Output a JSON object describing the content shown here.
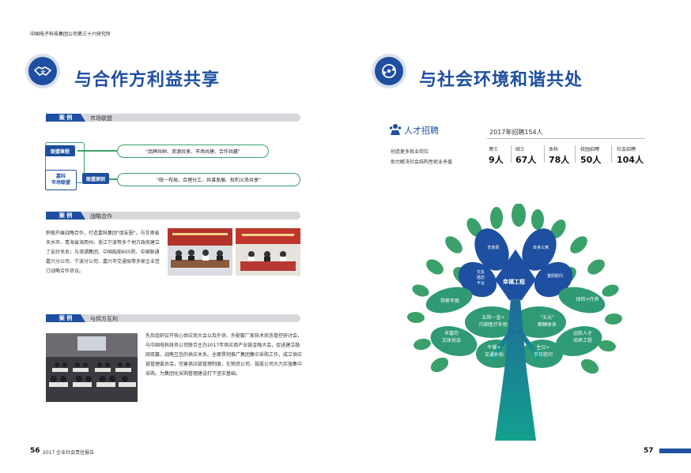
{
  "header": {
    "title": "中国电子科技集团公司第三十六研究所"
  },
  "left_section": {
    "title": "与合作方利益共享",
    "case_tag": "案 例",
    "cases": [
      {
        "name": "市场联盟"
      },
      {
        "name": "战略合作"
      },
      {
        "name": "与供方互利"
      }
    ],
    "alliance": {
      "box1": "联盟章程",
      "box2": "嘉科\n市场联盟",
      "box3": "联盟原则",
      "pill1": "\"品牌共树、资源共享、市场共建、合作共赢\"",
      "pill2": "\"统一布局、合理分工、共谋发展、权利义务共享\""
    },
    "strategic_text": "积极开展战略合作，打造嘉科集团\"朋友圈\"。与甘肃省天水市、青海省海西州、浙江宁波等多个地方政府建立了友好关系；与浪潮集团、中国船舶605院、中国联通嘉兴分公司、宁波分公司、嘉兴市交通局等多家企业签订战略合作协议。",
    "supplier_text": "先后组织召开核心供应商大会以及外协、外配套厂家技术状态管控研讨会，与中国电科财务公司联合主办2017年供应商产业链金融大会，促进建立稳固双赢、战略互信的供应关系。全面贯彻推广集团集中采购工作，成立供应链管理委员会，完善供应链管理制度，在物资公司、投股公司大力实施集中采购，为集团化采购管理建设打下坚实基础。"
  },
  "right_section": {
    "title": "与社会环境和谐共处",
    "talent": {
      "label": "人才招聘",
      "year_total": "2017年招聘154人",
      "desc1": "创造更多就业岗位",
      "desc2": "助力解决社会结构性就业矛盾",
      "stats": [
        {
          "head": "博士",
          "val": "9人"
        },
        {
          "head": "硕士",
          "val": "67人"
        },
        {
          "head": "本科",
          "val": "78人"
        },
        {
          "head": "校园招聘",
          "val": "50人"
        },
        {
          "head": "社会招聘",
          "val": "104人"
        }
      ]
    },
    "tree": {
      "top_left": "安家费",
      "top_right": "单身公寓",
      "mid_left": "交友\n婚恋\n平台",
      "center": "幸福工程",
      "mid_right": "重阳慰问",
      "left1": "带薪年假",
      "center_left": "五险一金+\n内部医疗补助",
      "center_right": "\"五元\"\n薪酬体系",
      "right1": "体检+疗养",
      "left2": "丰富的\n文体协会",
      "bottom_center": "午餐+\n交通补贴",
      "bottom_right": "生日+\n节日慰问",
      "right2": "远航人才\n培养工程"
    }
  },
  "footer": {
    "left_num": "56",
    "left_text": "2017 企业社会责任报告",
    "right_num": "57"
  },
  "colors": {
    "brand_blue": "#1e4fa0",
    "green": "#3aa16a",
    "teal": "#1a8a8a"
  }
}
